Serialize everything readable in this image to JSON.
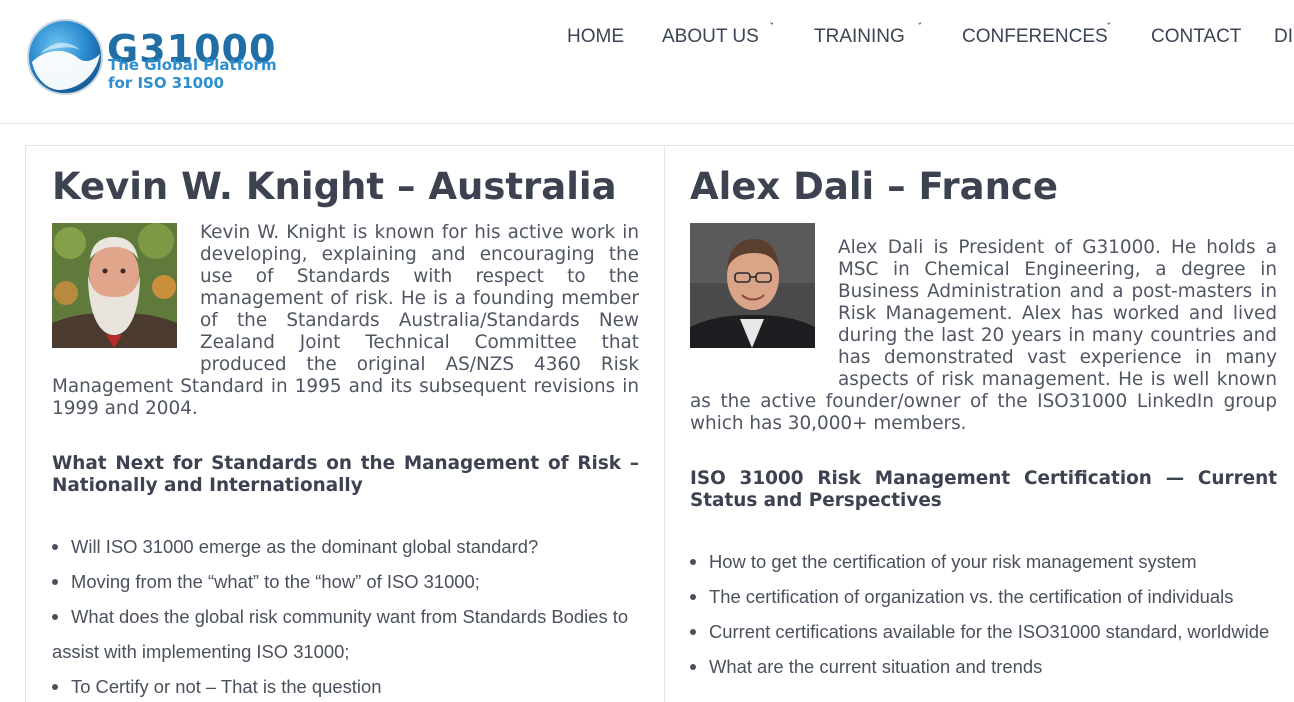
{
  "brand": {
    "name": "G31000",
    "tagline_1": "The Global Platform",
    "tagline_2": "for ISO 31000",
    "colors": {
      "primary": "#1f6fa6",
      "accent": "#2e8fd0"
    }
  },
  "nav": {
    "items": [
      {
        "label": "HOME",
        "has_dropdown": false
      },
      {
        "label": "ABOUT US",
        "has_dropdown": true
      },
      {
        "label": "TRAINING",
        "has_dropdown": true
      },
      {
        "label": "CONFERENCES",
        "has_dropdown": true
      },
      {
        "label": "CONTACT",
        "has_dropdown": false
      },
      {
        "label": "DIS",
        "has_dropdown": false
      }
    ]
  },
  "speakers": [
    {
      "name": "Kevin W. Knight – Australia",
      "bio": "Kevin W. Knight is known for his active work in developing, explaining and encouraging the use of Standards with respect to the management of risk. He is a founding member of the Standards Australia/Standards New Zealand Joint Technical Committee that produced the original AS/NZS 4360 Risk Management Standard in 1995 and its subsequent revisions in 1999 and 2004.",
      "talk_title": "What Next for Standards on the Management of Risk – Nationally and Internationally",
      "points": [
        "Will ISO 31000 emerge as the dominant global standard?",
        "Moving from the “what” to the “how” of ISO 31000;",
        "What does the global risk community want from Standards Bodies to",
        "assist with implementing ISO 31000;",
        "To Certify or not – That is the question"
      ]
    },
    {
      "name": "Alex Dali – France",
      "bio": "Alex Dali is President of G31000. He holds a MSC in Chemical Engineering, a degree in Business Administration and a post-masters in Risk Management. Alex has worked and lived during the last 20 years in many countries and has demonstrated vast experience in many aspects of risk management. He is well known as the active founder/owner of the ISO31000 LinkedIn group which has 30,000+ members.",
      "talk_title": "ISO 31000 Risk Management Certification — Current Status and Perspectives",
      "points": [
        "How to get the certification of your risk management system",
        "The certification of organization vs. the certification of individuals",
        "Current certifications available for the ISO31000 standard, worldwide",
        "What are the current situation and trends"
      ]
    }
  ]
}
